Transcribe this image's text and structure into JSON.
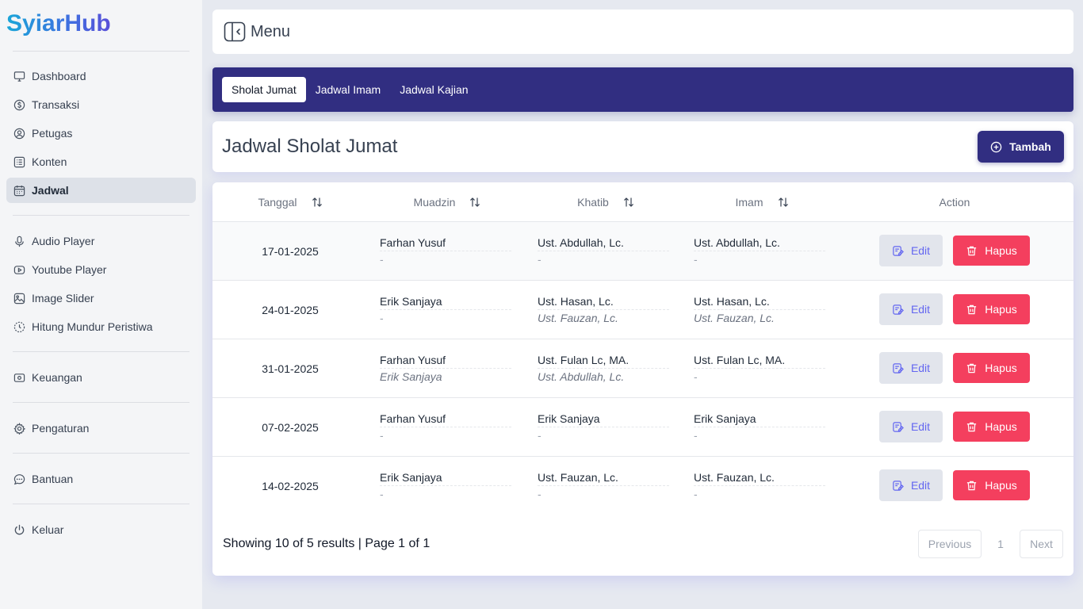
{
  "brand": "SyiarHub",
  "colors": {
    "accent": "#312e81",
    "danger": "#f43f5e",
    "edit_text": "#6366f1",
    "brand_from": "#1aa6d8",
    "brand_to": "#5a4fd8"
  },
  "sidebar": {
    "items": [
      {
        "label": "Dashboard",
        "icon": "monitor-icon"
      },
      {
        "label": "Transaksi",
        "icon": "dollar-circle-icon"
      },
      {
        "label": "Petugas",
        "icon": "user-circle-icon"
      },
      {
        "label": "Konten",
        "icon": "list-icon"
      },
      {
        "label": "Jadwal",
        "icon": "calendar-icon",
        "active": true
      },
      {
        "label": "Audio Player",
        "icon": "microphone-icon"
      },
      {
        "label": "Youtube Player",
        "icon": "youtube-icon"
      },
      {
        "label": "Image Slider",
        "icon": "image-icon"
      },
      {
        "label": "Hitung Mundur Peristiwa",
        "icon": "countdown-icon"
      },
      {
        "label": "Keuangan",
        "icon": "wallet-icon"
      },
      {
        "label": "Pengaturan",
        "icon": "gear-icon"
      },
      {
        "label": "Bantuan",
        "icon": "chat-icon"
      },
      {
        "label": "Keluar",
        "icon": "power-icon"
      }
    ]
  },
  "topbar": {
    "menu_label": "Menu",
    "menu_icon": "sidebar-toggle-icon"
  },
  "tabs": [
    {
      "label": "Sholat Jumat",
      "active": true
    },
    {
      "label": "Jadwal Imam"
    },
    {
      "label": "Jadwal Kajian"
    }
  ],
  "page": {
    "title": "Jadwal Sholat Jumat",
    "add_label": "Tambah"
  },
  "table": {
    "columns": [
      "Tanggal",
      "Muadzin",
      "Khatib",
      "Imam",
      "Action"
    ],
    "rows": [
      {
        "tanggal": "17-01-2025",
        "muadzin": "Farhan Yusuf",
        "muadzin_alt": "-",
        "khatib": "Ust. Abdullah, Lc.",
        "khatib_alt": "-",
        "imam": "Ust. Abdullah, Lc.",
        "imam_alt": "-"
      },
      {
        "tanggal": "24-01-2025",
        "muadzin": "Erik Sanjaya",
        "muadzin_alt": "-",
        "khatib": "Ust. Hasan, Lc.",
        "khatib_alt": "Ust. Fauzan, Lc.",
        "imam": "Ust. Hasan, Lc.",
        "imam_alt": "Ust. Fauzan, Lc."
      },
      {
        "tanggal": "31-01-2025",
        "muadzin": "Farhan Yusuf",
        "muadzin_alt": "Erik Sanjaya",
        "khatib": "Ust. Fulan Lc, MA.",
        "khatib_alt": "Ust. Abdullah, Lc.",
        "imam": "Ust. Fulan Lc, MA.",
        "imam_alt": "-"
      },
      {
        "tanggal": "07-02-2025",
        "muadzin": "Farhan Yusuf",
        "muadzin_alt": "-",
        "khatib": "Erik Sanjaya",
        "khatib_alt": "-",
        "imam": "Erik Sanjaya",
        "imam_alt": "-"
      },
      {
        "tanggal": "14-02-2025",
        "muadzin": "Erik Sanjaya",
        "muadzin_alt": "-",
        "khatib": "Ust. Fauzan, Lc.",
        "khatib_alt": "-",
        "imam": "Ust. Fauzan, Lc.",
        "imam_alt": "-"
      }
    ],
    "edit_label": "Edit",
    "delete_label": "Hapus"
  },
  "footer": {
    "summary": "Showing 10 of 5 results | Page 1 of 1",
    "previous": "Previous",
    "page": "1",
    "next": "Next"
  }
}
